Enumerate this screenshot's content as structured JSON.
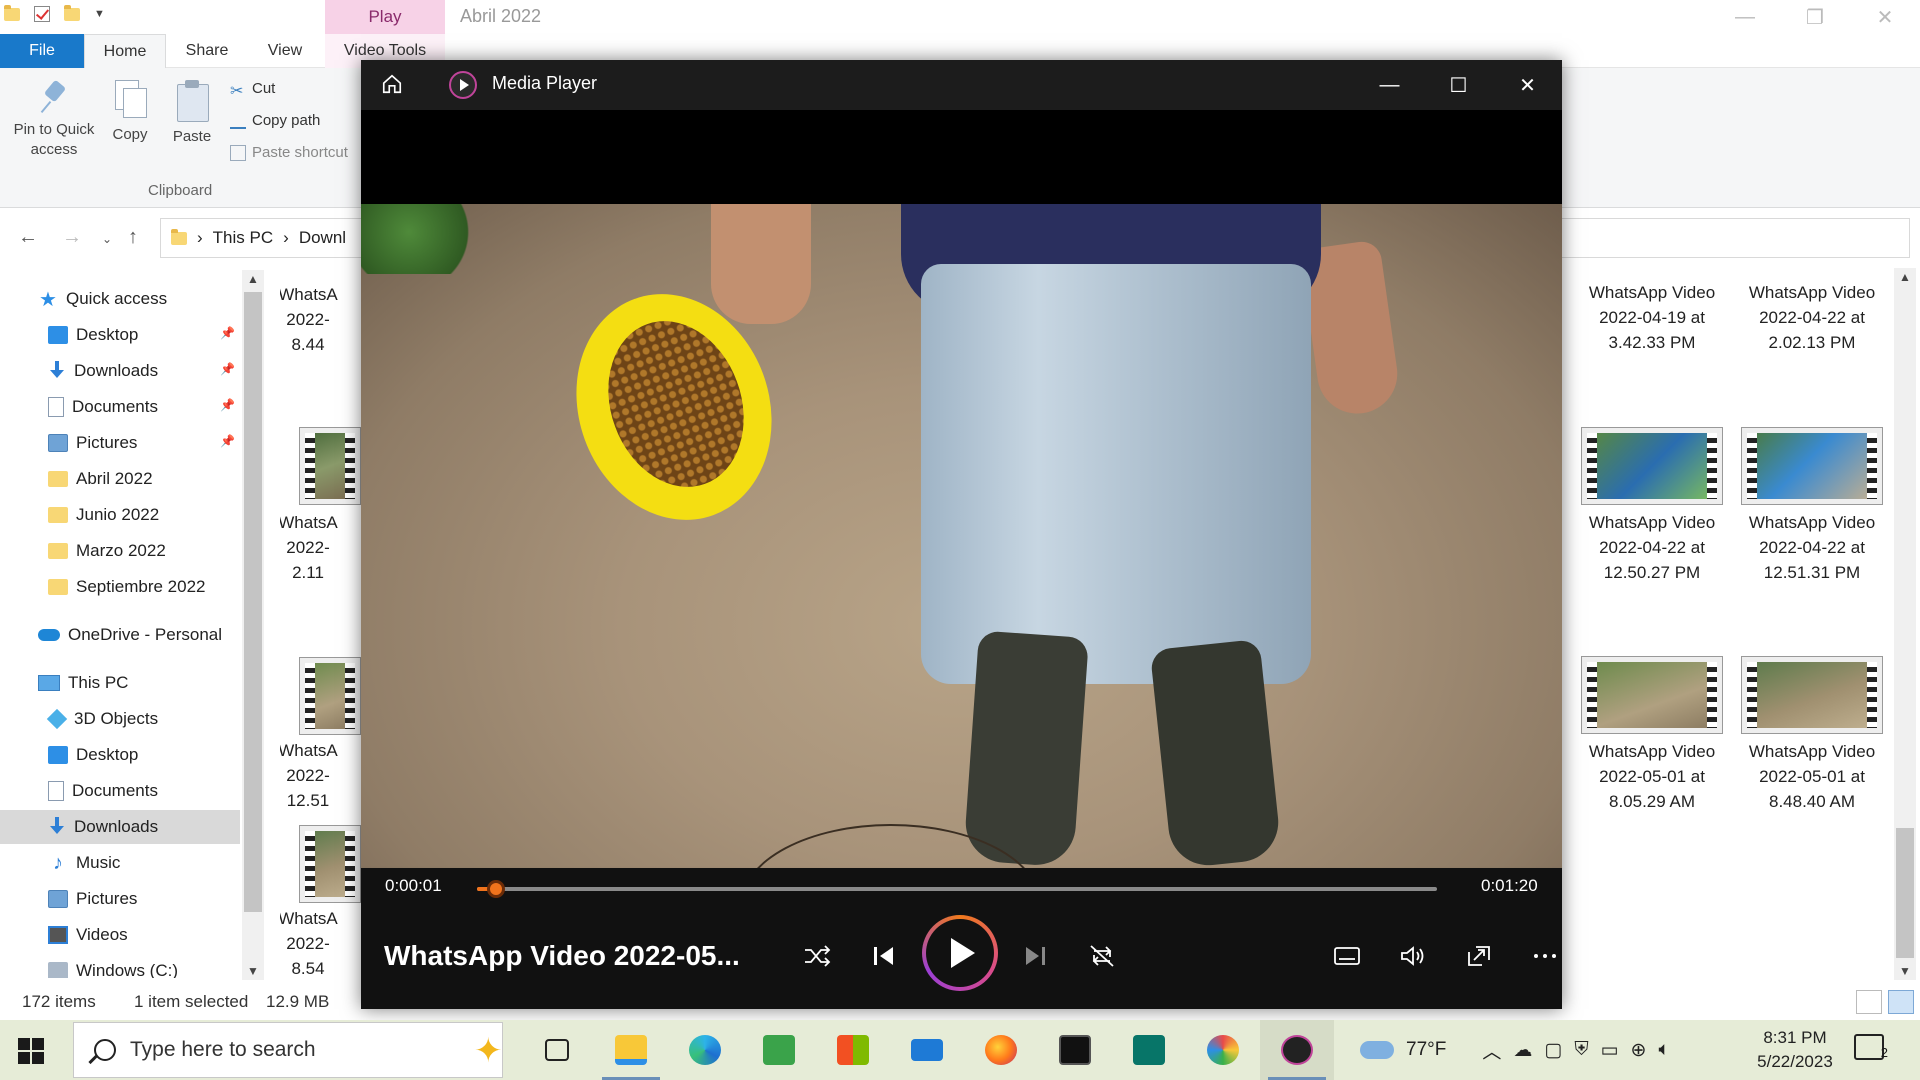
{
  "explorer": {
    "title": "Abril 2022",
    "contextual_tab": "Play",
    "tabs": [
      "File",
      "Home",
      "Share",
      "View",
      "Video Tools"
    ],
    "ribbon": {
      "pin": "Pin to Quick access",
      "copy": "Copy",
      "paste": "Paste",
      "cut": "Cut",
      "copy_path": "Copy path",
      "paste_shortcut": "Paste shortcut",
      "group_label": "Clipboard"
    },
    "address": {
      "seg1": "This PC",
      "seg2": "Downl"
    },
    "sidebar": [
      {
        "label": "Quick access",
        "icon": "star-icon"
      },
      {
        "label": "Desktop",
        "icon": "desktop-icon",
        "pinned": true
      },
      {
        "label": "Downloads",
        "icon": "download-icon",
        "pinned": true
      },
      {
        "label": "Documents",
        "icon": "documents-icon",
        "pinned": true
      },
      {
        "label": "Pictures",
        "icon": "pictures-icon",
        "pinned": true
      },
      {
        "label": "Abril 2022",
        "icon": "folder-icon"
      },
      {
        "label": "Junio 2022",
        "icon": "folder-icon"
      },
      {
        "label": "Marzo 2022",
        "icon": "folder-icon"
      },
      {
        "label": "Septiembre 2022",
        "icon": "folder-icon"
      },
      {
        "label": "OneDrive - Personal",
        "icon": "cloud-icon"
      },
      {
        "label": "This PC",
        "icon": "computer-icon"
      },
      {
        "label": "3D Objects",
        "icon": "cube-icon"
      },
      {
        "label": "Desktop",
        "icon": "desktop-icon"
      },
      {
        "label": "Documents",
        "icon": "documents-icon"
      },
      {
        "label": "Downloads",
        "icon": "download-icon",
        "selected": true
      },
      {
        "label": "Music",
        "icon": "music-icon"
      },
      {
        "label": "Pictures",
        "icon": "pictures-icon"
      },
      {
        "label": "Videos",
        "icon": "videos-icon"
      },
      {
        "label": "Windows (C:)",
        "icon": "drive-icon"
      }
    ],
    "files_left": [
      {
        "l1": "WhatsA",
        "l2": "2022-",
        "l3": "8.44"
      },
      {
        "l1": "WhatsA",
        "l2": "2022-",
        "l3": "2.11"
      },
      {
        "l1": "WhatsA",
        "l2": "2022-",
        "l3": "12.51"
      },
      {
        "l1": "WhatsA",
        "l2": "2022-",
        "l3": "8.54"
      }
    ],
    "files_right": [
      {
        "l1": "WhatsApp Video",
        "l2": "2022-04-19 at",
        "l3": "3.42.33 PM"
      },
      {
        "l1": "WhatsApp Video",
        "l2": "2022-04-22 at",
        "l3": "2.02.13 PM"
      },
      {
        "l1": "WhatsApp Video",
        "l2": "2022-04-22 at",
        "l3": "12.50.27 PM"
      },
      {
        "l1": "WhatsApp Video",
        "l2": "2022-04-22 at",
        "l3": "12.51.31 PM"
      },
      {
        "l1": "WhatsApp Video",
        "l2": "2022-05-01 at",
        "l3": "8.05.29 AM"
      },
      {
        "l1": "WhatsApp Video",
        "l2": "2022-05-01 at",
        "l3": "8.48.40 AM"
      }
    ],
    "status": {
      "items": "172 items",
      "selected": "1 item selected",
      "size": "12.9 MB"
    }
  },
  "player": {
    "app_name": "Media Player",
    "current_time": "0:00:01",
    "total_time": "0:01:20",
    "progress": 0.02,
    "track_title": "WhatsApp Video 2022-05..."
  },
  "taskbar": {
    "search_placeholder": "Type here to search",
    "weather": "77°F",
    "time": "8:31 PM",
    "date": "5/22/2023",
    "notification_count": "2",
    "apps": [
      {
        "name": "task-view-icon",
        "open": false
      },
      {
        "name": "file-explorer-icon",
        "open": true
      },
      {
        "name": "edge-icon",
        "open": false
      },
      {
        "name": "game-app-icon",
        "open": false
      },
      {
        "name": "microsoft-store-icon",
        "open": false
      },
      {
        "name": "mail-icon",
        "open": false
      },
      {
        "name": "firefox-icon",
        "open": false
      },
      {
        "name": "terminal-icon",
        "open": false
      },
      {
        "name": "publisher-icon",
        "open": false
      },
      {
        "name": "paint-icon",
        "open": false
      },
      {
        "name": "media-player-icon",
        "open": true
      }
    ]
  },
  "colors": {
    "accent": "#1979ca",
    "seek": "#f0731c",
    "taskbar": "#e6ecd7",
    "contextual_tab": "#f7d2e7"
  }
}
